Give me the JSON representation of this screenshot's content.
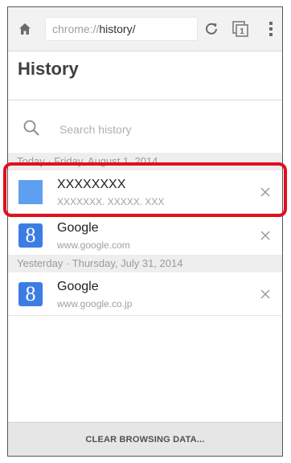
{
  "toolbar": {
    "url_scheme": "chrome://",
    "url_path": "history/",
    "home_icon": "home-icon",
    "reload_icon": "reload-icon",
    "tabs_icon": "tab-switcher-icon",
    "tab_count": "1",
    "menu_icon": "overflow-menu-icon"
  },
  "page": {
    "title": "History"
  },
  "search": {
    "placeholder": "Search history",
    "icon": "search-icon"
  },
  "sections": [
    {
      "header": "Today · Friday, August 1, 2014",
      "entries": [
        {
          "title": "XXXXXXXX",
          "url": "XXXXXXX. XXXXX. XXX",
          "favicon": "blank-page-icon"
        },
        {
          "title": "Google",
          "url": "www.google.com",
          "favicon": "google-icon",
          "favicon_letter": "8"
        }
      ]
    },
    {
      "header": "Yesterday · Thursday, July 31, 2014",
      "entries": [
        {
          "title": "Google",
          "url": "www.google.co.jp",
          "favicon": "google-icon",
          "favicon_letter": "8"
        }
      ]
    }
  ],
  "footer": {
    "clear_label": "CLEAR BROWSING DATA..."
  },
  "colors": {
    "highlight": "#e0101e",
    "google_blue": "#3b7de3",
    "blank_favicon": "#5e9ff2"
  }
}
